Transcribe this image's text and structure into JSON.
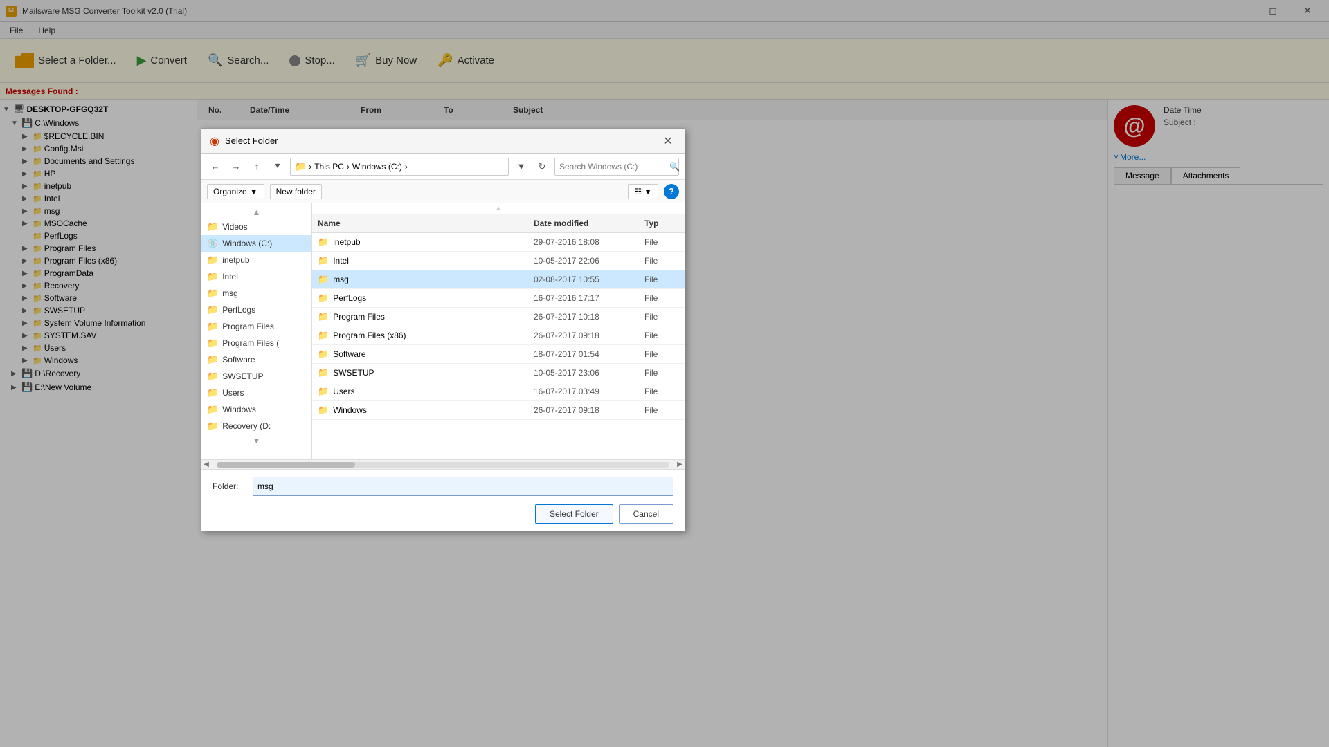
{
  "app": {
    "title": "Mailsware MSG Converter Toolkit v2.0 (Trial)"
  },
  "menu": {
    "items": [
      "File",
      "Help"
    ]
  },
  "toolbar": {
    "select_folder": "Select a Folder...",
    "convert": "Convert",
    "search": "Search...",
    "stop": "Stop...",
    "buy_now": "Buy Now",
    "activate": "Activate"
  },
  "messages_found": "Messages Found :",
  "tree": {
    "root": "DESKTOP-GFGQ32T",
    "nodes": [
      {
        "label": "C:\\Windows",
        "indent": 1,
        "type": "drive",
        "expanded": true
      },
      {
        "label": "$RECYCLE.BIN",
        "indent": 2
      },
      {
        "label": "Config.Msi",
        "indent": 2
      },
      {
        "label": "Documents and Settings",
        "indent": 2
      },
      {
        "label": "HP",
        "indent": 2
      },
      {
        "label": "inetpub",
        "indent": 2
      },
      {
        "label": "Intel",
        "indent": 2
      },
      {
        "label": "msg",
        "indent": 2
      },
      {
        "label": "MSOCache",
        "indent": 2
      },
      {
        "label": "PerfLogs",
        "indent": 2
      },
      {
        "label": "Program Files",
        "indent": 2
      },
      {
        "label": "Program Files (x86)",
        "indent": 2
      },
      {
        "label": "ProgramData",
        "indent": 2
      },
      {
        "label": "Recovery",
        "indent": 2
      },
      {
        "label": "Software",
        "indent": 2
      },
      {
        "label": "SWSETUP",
        "indent": 2
      },
      {
        "label": "System Volume Information",
        "indent": 2
      },
      {
        "label": "SYSTEM.SAV",
        "indent": 2
      },
      {
        "label": "Users",
        "indent": 2
      },
      {
        "label": "Windows",
        "indent": 2
      },
      {
        "label": "D:\\Recovery",
        "indent": 1,
        "type": "drive"
      },
      {
        "label": "E:\\New Volume",
        "indent": 1,
        "type": "drive"
      }
    ]
  },
  "table": {
    "headers": {
      "no": "No.",
      "datetime": "Date/Time",
      "from": "From",
      "to": "To",
      "subject": "Subject"
    }
  },
  "detail": {
    "at_symbol": "@",
    "date_time_label": "Date Time",
    "subject_label": "Subject :",
    "more_label": "More...",
    "tabs": [
      "Message",
      "Attachments"
    ]
  },
  "dialog": {
    "title": "Select Folder",
    "breadcrumb": {
      "this_pc": "This PC",
      "drive": "Windows (C:)",
      "sep": "›"
    },
    "search_placeholder": "Search Windows (C:)",
    "organize_label": "Organize",
    "new_folder_label": "New folder",
    "file_list_headers": {
      "name": "Name",
      "date_modified": "Date modified",
      "type": "Typ"
    },
    "nav_items": [
      {
        "label": "Videos",
        "icon": "folder"
      },
      {
        "label": "Windows (C:)",
        "icon": "drive"
      },
      {
        "label": "inetpub",
        "icon": "folder"
      },
      {
        "label": "Intel",
        "icon": "folder"
      },
      {
        "label": "msg",
        "icon": "folder"
      },
      {
        "label": "PerfLogs",
        "icon": "folder"
      },
      {
        "label": "Program Files",
        "icon": "folder"
      },
      {
        "label": "Program Files (",
        "icon": "folder"
      },
      {
        "label": "Software",
        "icon": "folder"
      },
      {
        "label": "SWSETUP",
        "icon": "folder"
      },
      {
        "label": "Users",
        "icon": "folder"
      },
      {
        "label": "Windows",
        "icon": "folder"
      },
      {
        "label": "Recovery (D:",
        "icon": "folder"
      }
    ],
    "files": [
      {
        "name": "inetpub",
        "date": "29-07-2016 18:08",
        "type": "File",
        "selected": false
      },
      {
        "name": "Intel",
        "date": "10-05-2017 22:06",
        "type": "File",
        "selected": false
      },
      {
        "name": "msg",
        "date": "02-08-2017 10:55",
        "type": "File",
        "selected": true
      },
      {
        "name": "PerfLogs",
        "date": "16-07-2016 17:17",
        "type": "File",
        "selected": false
      },
      {
        "name": "Program Files",
        "date": "26-07-2017 10:18",
        "type": "File",
        "selected": false
      },
      {
        "name": "Program Files (x86)",
        "date": "26-07-2017 09:18",
        "type": "File",
        "selected": false
      },
      {
        "name": "Software",
        "date": "18-07-2017 01:54",
        "type": "File",
        "selected": false
      },
      {
        "name": "SWSETUP",
        "date": "10-05-2017 23:06",
        "type": "File",
        "selected": false
      },
      {
        "name": "Users",
        "date": "16-07-2017 03:49",
        "type": "File",
        "selected": false
      },
      {
        "name": "Windows",
        "date": "26-07-2017 09:18",
        "type": "File",
        "selected": false
      }
    ],
    "folder_label": "Folder:",
    "folder_value": "msg",
    "select_btn": "Select Folder",
    "cancel_btn": "Cancel"
  }
}
